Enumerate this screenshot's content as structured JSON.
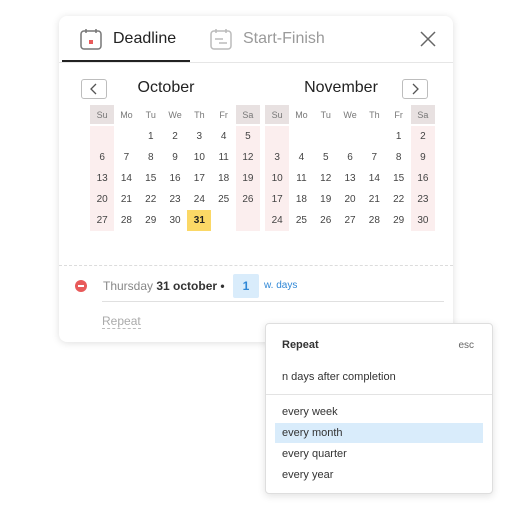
{
  "tabs": {
    "deadline": "Deadline",
    "start_finish": "Start-Finish",
    "active": "deadline"
  },
  "calendar": {
    "left": {
      "month": "October",
      "day_headers": [
        "Su",
        "Mo",
        "Tu",
        "We",
        "Th",
        "Fr",
        "Sa"
      ],
      "weeks": [
        [
          "",
          "",
          "1",
          "2",
          "3",
          "4",
          "5"
        ],
        [
          "6",
          "7",
          "8",
          "9",
          "10",
          "11",
          "12"
        ],
        [
          "13",
          "14",
          "15",
          "16",
          "17",
          "18",
          "19"
        ],
        [
          "20",
          "21",
          "22",
          "23",
          "24",
          "25",
          "26"
        ],
        [
          "27",
          "28",
          "29",
          "30",
          "31",
          "",
          ""
        ]
      ],
      "selected": "31"
    },
    "right": {
      "month": "November",
      "day_headers": [
        "Su",
        "Mo",
        "Tu",
        "We",
        "Th",
        "Fr",
        "Sa"
      ],
      "weeks": [
        [
          "",
          "",
          "",
          "",
          "",
          "1",
          "2"
        ],
        [
          "3",
          "4",
          "5",
          "6",
          "7",
          "8",
          "9"
        ],
        [
          "10",
          "11",
          "12",
          "13",
          "14",
          "15",
          "16"
        ],
        [
          "17",
          "18",
          "19",
          "20",
          "21",
          "22",
          "23"
        ],
        [
          "24",
          "25",
          "26",
          "27",
          "28",
          "29",
          "30"
        ]
      ],
      "selected": ""
    }
  },
  "deadline_row": {
    "weekday": "Thursday",
    "date": "31 october",
    "bullet": "•",
    "offset_value": "1",
    "offset_unit": "w. days"
  },
  "repeat_link": "Repeat",
  "repeat_popup": {
    "title": "Repeat",
    "esc": "esc",
    "after_completion": "n days after completion",
    "options": [
      "every week",
      "every month",
      "every quarter",
      "every year"
    ],
    "selected": "every month"
  },
  "colors": {
    "accent": "#2f87d6",
    "selected_day": "#fbd866",
    "weekend_bg": "#fbeeee",
    "remove": "#e85a5a"
  }
}
